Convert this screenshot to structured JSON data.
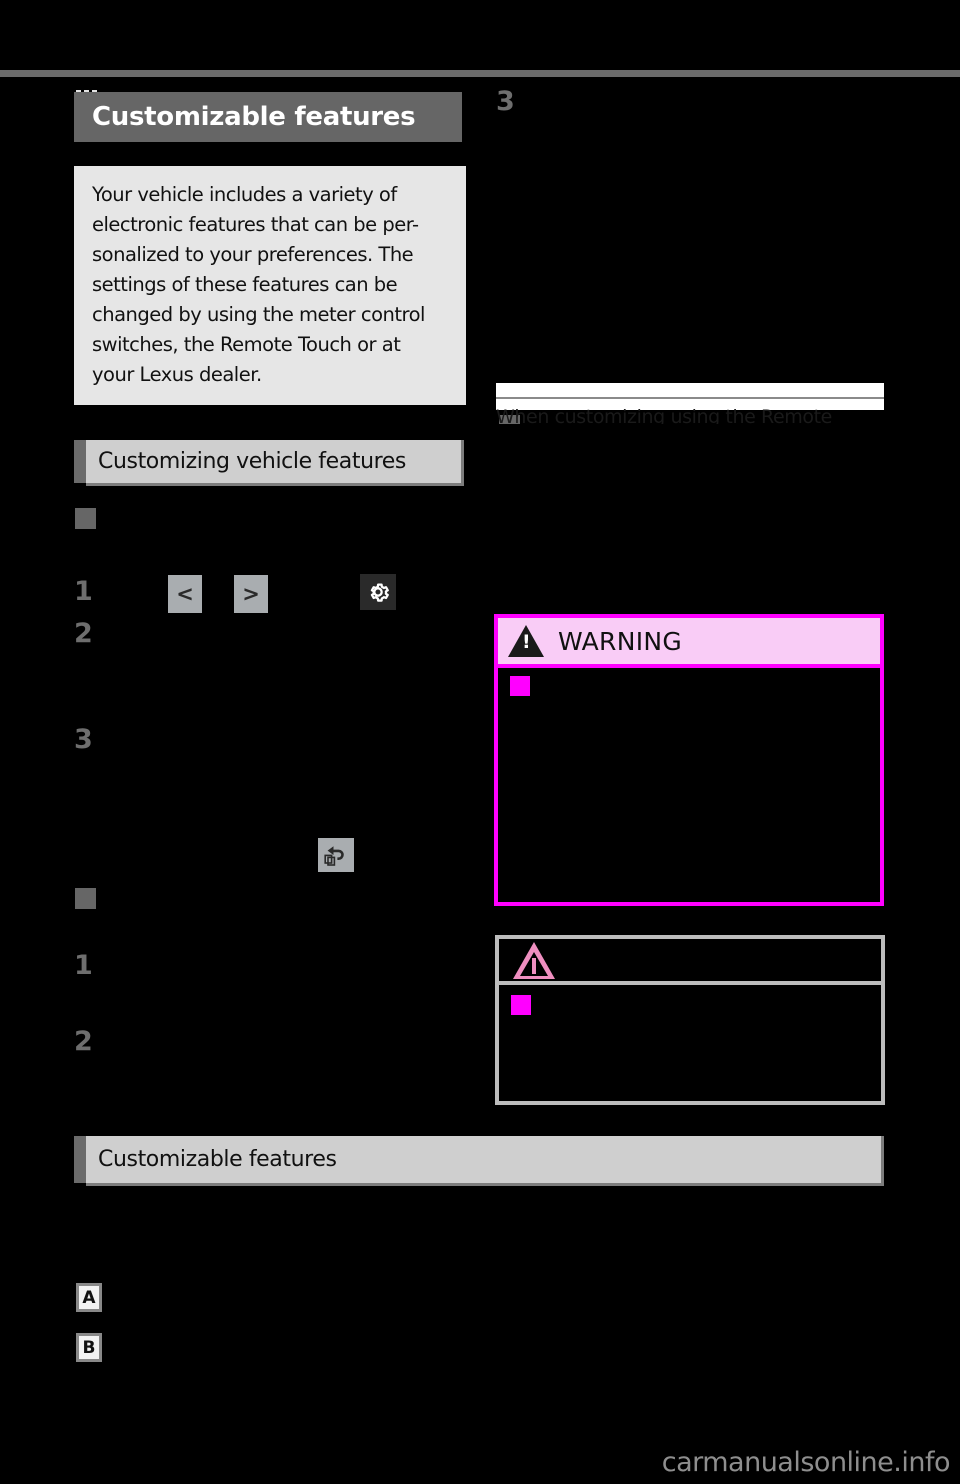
{
  "page": {
    "background_color": "#000000",
    "watermark": "carmanualsonline.info"
  },
  "chapter": {
    "title": "Customizable features",
    "bar_color": "#666666"
  },
  "intro": {
    "text": "Your vehicle includes a variety of electronic features that can be personalized to your preferences. The settings of these features can be changed by using the meter control switches, the Remote Touch or at your Lexus dealer.",
    "lines": [
      "Your vehicle includes a variety of",
      "electronic features that can be per-",
      "sonalized to your preferences. The",
      "settings of these features can be",
      "changed by using the meter control",
      "switches, the Remote Touch or at",
      "your Lexus dealer."
    ],
    "panel_color": "#e6e6e6"
  },
  "sections": {
    "customizing": {
      "label": "Customizing vehicle features",
      "bar_color": "#cfcfcf",
      "tab_color": "#6b6b6b"
    },
    "customizable_table": {
      "label": "Customizable features",
      "bar_color": "#cfcfcf",
      "tab_color": "#6b6b6b"
    }
  },
  "left_column": {
    "subheading_bullet_1": "■",
    "subheading_bullet_2": "■",
    "steps": {
      "step_1": "1",
      "step_2": "2",
      "step_3": "3",
      "step_1b": "1",
      "step_2b": "2"
    },
    "icons": {
      "prev_key": "<",
      "next_key": ">",
      "gear": "gear-icon",
      "return": "return-icon"
    }
  },
  "right_column": {
    "step_3": "3",
    "band_heading": "When customizing using the Remote"
  },
  "warning": {
    "label": "WARNING",
    "header_bg": "#f9ccf6",
    "border_color": "#ff00ff",
    "bullet_color": "#ff00ff"
  },
  "notice": {
    "label": "",
    "border_color": "#bdbdbd",
    "triangle_color": "#ef8fc0",
    "bullet_color": "#ff00ff"
  },
  "legend": {
    "item_a": "A",
    "item_b": "B"
  }
}
